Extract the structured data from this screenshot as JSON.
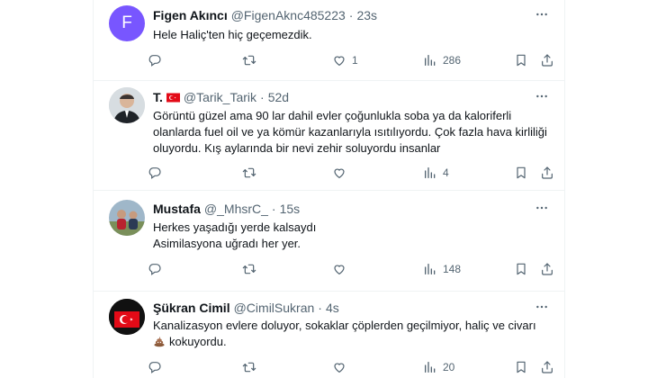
{
  "tweets": [
    {
      "name": "Figen Akıncı",
      "handle": "@FigenAknc485223",
      "time": "23s",
      "avatar_letter": "F",
      "lines": [
        "Hele Haliç'ten hiç geçemezdik."
      ],
      "replies": "",
      "retweets": "",
      "likes": "1",
      "views": "286"
    },
    {
      "name": "T.",
      "handle": "@Tarik_Tarik",
      "time": "52d",
      "lines": [
        "Görüntü güzel ama 90 lar dahil evler çoğunlukla soba ya da kaloriferli",
        "olanlarda fuel oil ve ya kömür kazanlarıyla ısıtılıyordu. Çok fazla hava kirliliği",
        "oluyordu. Kış aylarında bir nevi zehir soluyordu insanlar"
      ],
      "replies": "",
      "retweets": "",
      "likes": "",
      "views": "4"
    },
    {
      "name": "Mustafa",
      "handle": "@_MhsrC_",
      "time": "15s",
      "lines": [
        "Herkes yaşadığı yerde kalsaydı",
        "Asimilasyona uğradı her yer."
      ],
      "replies": "",
      "retweets": "",
      "likes": "",
      "views": "148"
    },
    {
      "name": "Şükran Cimil",
      "handle": "@CimilSukran",
      "time": "4s",
      "lines": [
        "Kanalizasyon evlere doluyor, sokaklar çöplerden geçilmiyor, haliç  ve civarı",
        "kokuyordu."
      ],
      "replies": "",
      "retweets": "",
      "likes": "",
      "views": "20"
    }
  ],
  "icons": {
    "reply": "reply-icon",
    "retweet": "retweet-icon",
    "like": "heart-icon",
    "views": "views-icon",
    "bookmark": "bookmark-icon",
    "share": "share-icon",
    "more": "more-icon",
    "emoji": "poop-emoji"
  },
  "colors": {
    "text": "#0f1419",
    "secondary": "#536471",
    "border": "#eff3f4",
    "avatar_purple": "#7856ff",
    "turkey_red": "#e30a17"
  }
}
